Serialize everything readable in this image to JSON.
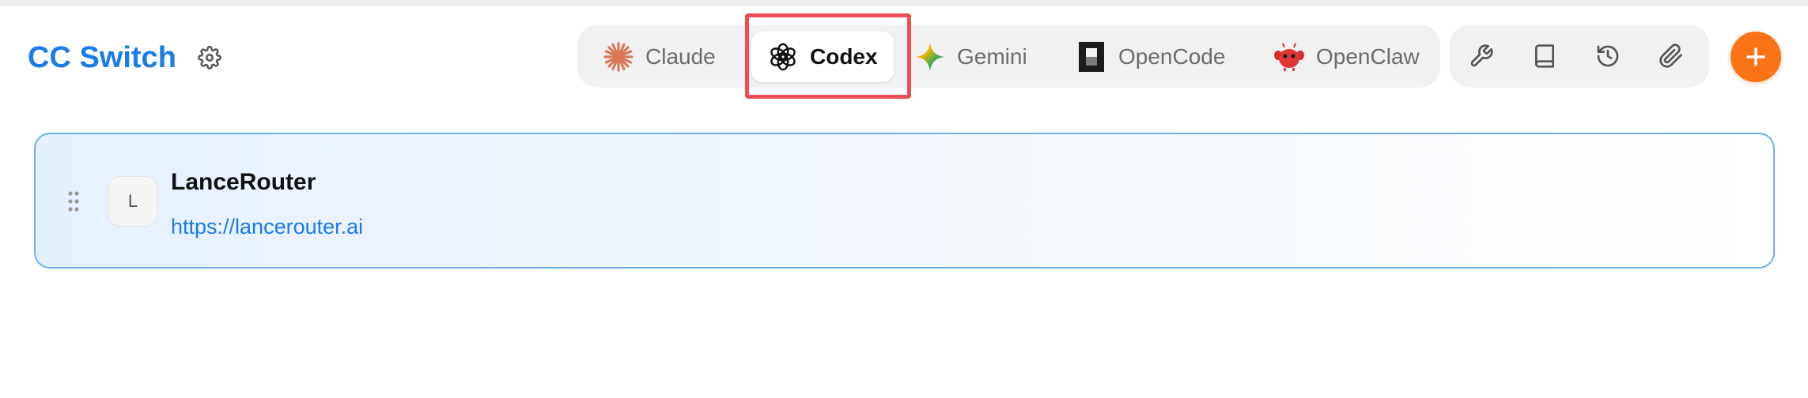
{
  "app": {
    "title": "CC Switch"
  },
  "header": {
    "settings_icon": "gear-icon",
    "tabs": [
      {
        "label": "Claude",
        "icon": "claude-sunburst-icon",
        "active": false
      },
      {
        "label": "Codex",
        "icon": "openai-knot-icon",
        "active": true
      },
      {
        "label": "Gemini",
        "icon": "gemini-star-icon",
        "active": false
      },
      {
        "label": "OpenCode",
        "icon": "opencode-icon",
        "active": false
      },
      {
        "label": "OpenClaw",
        "icon": "openclaw-crab-icon",
        "active": false
      }
    ],
    "tools": [
      {
        "icon": "wrench-icon"
      },
      {
        "icon": "book-icon"
      },
      {
        "icon": "history-icon"
      },
      {
        "icon": "paperclip-icon"
      }
    ],
    "add_icon": "plus-icon"
  },
  "providers": [
    {
      "initial": "L",
      "name": "LanceRouter",
      "url": "https://lancerouter.ai"
    }
  ],
  "colors": {
    "brand": "#1a7bea",
    "accent": "#f97316",
    "highlight": "#ec4e55",
    "card_border": "#6aaef2"
  }
}
